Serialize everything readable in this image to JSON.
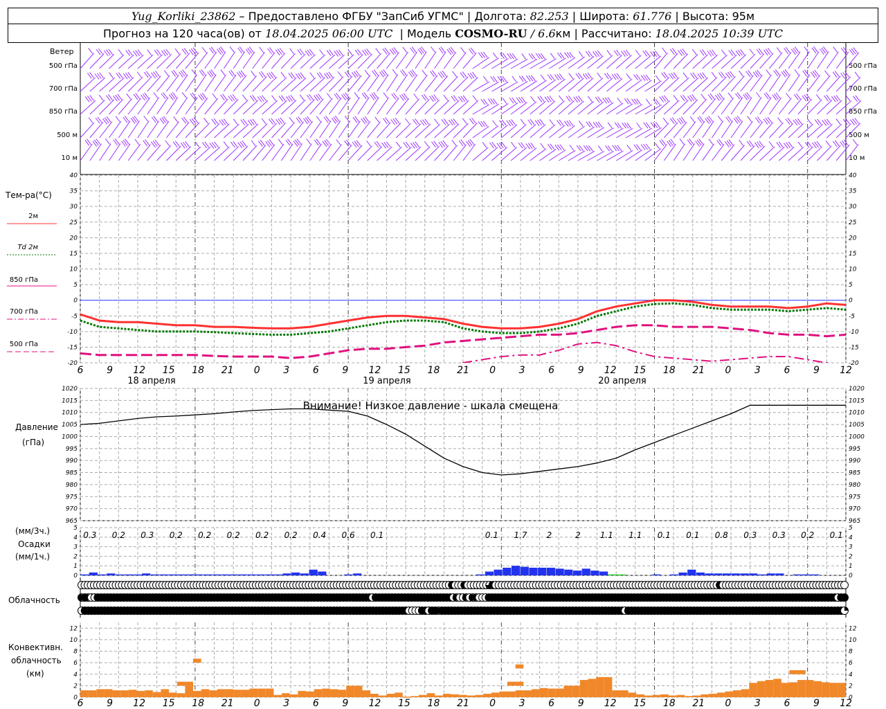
{
  "header": {
    "line1": {
      "station": "Yug_Korliki_23862",
      "provider": " – Предоставлено ФГБУ \"ЗапСиб УГМС\" | Долгота: ",
      "lon": "82.253",
      "lat_label": " | Широта: ",
      "lat": "61.776",
      "alt_label": " | Высота: ",
      "alt": "95м"
    },
    "line2": {
      "forecast_label": "Прогноз на 120 часа(ов) от ",
      "start": "18.04.2025 06:00 UTC",
      "model_label": "  | Модель ",
      "model": "COSMO-RU",
      "resolution": " / 6.6",
      "resolution_unit": "км",
      "calc_label": " | Рассчитано: ",
      "calc": "18.04.2025 10:39 UTC"
    }
  },
  "wind_panel": {
    "title": "Ветер",
    "levels": [
      "500 гПа",
      "700 гПа",
      "850 гПа",
      "500 м",
      "10 м"
    ],
    "color": "#9b30ff"
  },
  "temp_panel": {
    "title": "Тем-ра(°C)",
    "legend": [
      {
        "label": "2м",
        "color": "#ff3030",
        "style": "solid"
      },
      {
        "label": "Td 2м",
        "color": "#007700",
        "style": "dotted"
      },
      {
        "label": "850 гПа",
        "color": "#e0107f",
        "style": "solid"
      },
      {
        "label": "700 гПа",
        "color": "#e0107f",
        "style": "dashdot"
      },
      {
        "label": "500 гПа",
        "color": "#e0107f",
        "style": "dashed"
      }
    ],
    "yticks": [
      40,
      35,
      30,
      25,
      20,
      15,
      10,
      5,
      0,
      -5,
      -10,
      -15,
      -20
    ]
  },
  "pressure_panel": {
    "title": "Давление",
    "unit": "(гПа)",
    "warning": "Внимание! Низкое давление - шкала смещена",
    "yticks": [
      1020,
      1015,
      1010,
      1005,
      1000,
      995,
      990,
      985,
      980,
      975,
      970,
      965
    ]
  },
  "precip_panel": {
    "unit3": "(мм/3ч.)",
    "title": "Осадки",
    "unit1": "(мм/1ч.)",
    "labels": [
      "0.3",
      "0.2",
      "0.3",
      "0.2",
      "0.2",
      "0.2",
      "0.2",
      "0.2",
      "0.4",
      "0.6",
      "0.1",
      "",
      "",
      "",
      "0.1",
      "1.7",
      "2",
      "2",
      "1.1",
      "1.1",
      "0.1",
      "0.1",
      "0.8",
      "0.3",
      "0.3",
      "0.2",
      "0.1"
    ],
    "yticks": [
      5,
      4,
      3,
      2,
      1,
      0
    ]
  },
  "cloud_panel": {
    "title": "Облачность"
  },
  "conv_panel": {
    "title_line1": "Конвективн.",
    "title_line2": "облачность",
    "unit": "(км)",
    "yticks": [
      12,
      10,
      8,
      6,
      4,
      2,
      0
    ]
  },
  "x_axis": {
    "hour_labels": [
      "6",
      "9",
      "12",
      "15",
      "18",
      "21",
      "0",
      "3",
      "6",
      "9",
      "12",
      "15",
      "18",
      "21",
      "0",
      "3",
      "6",
      "9",
      "12",
      "15",
      "18",
      "21",
      "0",
      "3",
      "6",
      "9",
      "12"
    ],
    "dates": [
      "18 апреля",
      "19 апреля",
      "20 апреля"
    ]
  },
  "chart_data": {
    "type": "line",
    "x_hours_from_start": [
      0,
      3,
      6,
      9,
      12,
      15,
      18,
      21,
      24,
      27,
      30,
      33,
      36,
      39,
      42,
      45,
      48,
      51,
      54,
      57,
      60,
      63,
      66,
      69,
      72,
      75,
      78,
      81,
      84,
      87,
      90,
      93,
      96,
      99,
      102,
      105,
      108,
      111,
      114,
      117,
      120
    ],
    "series_temperature": [
      {
        "name": "2м",
        "values": [
          -4.5,
          -6.5,
          -7,
          -7,
          -7.5,
          -8,
          -8,
          -8.5,
          -8.5,
          -8.8,
          -9,
          -9,
          -8.5,
          -7.5,
          -6.5,
          -5.5,
          -5,
          -5,
          -5.5,
          -6,
          -7.5,
          -8.5,
          -9,
          -9,
          -8.5,
          -7.5,
          -6,
          -3.5,
          -2,
          -1,
          0,
          0,
          -0.5,
          -1.5,
          -2,
          -2,
          -2,
          -2.5,
          -2,
          -1,
          -1.5
        ]
      },
      {
        "name": "Td 2м",
        "values": [
          -6.5,
          -8.5,
          -9,
          -9.5,
          -10,
          -10,
          -10,
          -10.2,
          -10.5,
          -10.8,
          -11,
          -11,
          -10.5,
          -10,
          -9,
          -8,
          -7,
          -6.5,
          -6.5,
          -7,
          -9,
          -10,
          -10.5,
          -10.5,
          -10,
          -9,
          -7.5,
          -5,
          -3.5,
          -2,
          -1.2,
          -1,
          -1.5,
          -2.5,
          -3,
          -3,
          -3,
          -3.5,
          -3,
          -2.5,
          -3
        ]
      },
      {
        "name": "850 гПа",
        "values": [
          -17,
          -17.5,
          -17.5,
          -17.5,
          -17.5,
          -17.5,
          -17.5,
          -17.8,
          -18,
          -18,
          -18,
          -18.5,
          -18,
          -17,
          -16,
          -15.5,
          -15.5,
          -15,
          -14.5,
          -13.5,
          -13,
          -12.5,
          -12,
          -11.5,
          -11,
          -11,
          -10.5,
          -9.5,
          -8.5,
          -8,
          -8,
          -8.5,
          -8.5,
          -8.5,
          -9,
          -9.5,
          -10.5,
          -11,
          -11,
          -11.5,
          -11
        ]
      },
      {
        "name": "700 гПа",
        "values": [
          null,
          null,
          null,
          null,
          null,
          null,
          null,
          null,
          null,
          null,
          null,
          null,
          null,
          null,
          null,
          null,
          null,
          null,
          null,
          -21,
          -20,
          -19,
          -18,
          -17.5,
          -17.5,
          -16,
          -14,
          -13.5,
          -14.5,
          -16.5,
          -18,
          -18.5,
          -19,
          -19.5,
          -19,
          -18.5,
          -18,
          -18,
          -19,
          -20,
          -21
        ]
      },
      {
        "name": "500 гПа",
        "values": []
      }
    ],
    "series_pressure": {
      "name": "Давление",
      "values": [
        1005,
        1005.5,
        1006.5,
        1007.5,
        1008.2,
        1008.5,
        1009,
        1009.5,
        1010.2,
        1010.8,
        1011.2,
        1011.5,
        1011.5,
        1011,
        1010.5,
        1008.5,
        1005,
        1001,
        996,
        991,
        987.5,
        985,
        984,
        984.5,
        985.5,
        986.5,
        987.5,
        989,
        991,
        994.5,
        997.5,
        1000.5,
        1003.5,
        1006.5,
        1009.5,
        1013,
        1013,
        1013,
        1013,
        1013,
        1013
      ]
    },
    "precip_1h_mm": [
      0.1,
      0.3,
      0.1,
      0.2,
      0.1,
      0.1,
      0.1,
      0.2,
      0.1,
      0.1,
      0.1,
      0.1,
      0.1,
      0.1,
      0.1,
      0.1,
      0.1,
      0.1,
      0.1,
      0.1,
      0.1,
      0.1,
      0.1,
      0.2,
      0.3,
      0.2,
      0.6,
      0.4,
      0.0,
      0.0,
      0.1,
      0.2,
      0.0,
      0.0,
      0.0,
      0.0,
      0.0,
      0.0,
      0.0,
      0.0,
      0.0,
      0.0,
      0.0,
      0.0,
      0.0,
      0.1,
      0.4,
      0.6,
      0.8,
      1.0,
      0.9,
      0.8,
      0.8,
      0.8,
      0.7,
      0.6,
      0.5,
      0.7,
      0.5,
      0.4,
      0.1,
      0.1,
      0.0,
      0.0,
      0.0,
      0.1,
      0.0,
      0.1,
      0.3,
      0.6,
      0.3,
      0.2,
      0.2,
      0.2,
      0.2,
      0.2,
      0.2,
      0.1,
      0.2,
      0.2,
      0.0,
      0.1,
      0.1,
      0.1,
      0.0,
      0.0,
      0.0
    ],
    "precip_green_index": [
      60,
      61
    ],
    "conv_cloud_km": [
      [
        1.2,
        1.8
      ],
      [
        1.2,
        1.8
      ],
      [
        1.4,
        1.7
      ],
      [
        1.4,
        1.7
      ],
      [
        1.2,
        1.6
      ],
      [
        1.2,
        1.8
      ],
      [
        1.3,
        1.7
      ],
      [
        1.1,
        1.7
      ],
      [
        1.2,
        1.6
      ],
      [
        0.9,
        1.6
      ],
      [
        1.4,
        1.6
      ],
      [
        0.8,
        1.3
      ],
      [
        0.7,
        1.1
      ],
      [
        2.0,
        1.1
      ],
      [
        1.1,
        0.8
      ],
      [
        1.4,
        0.8
      ],
      [
        1.2,
        0.9
      ],
      [
        1.4,
        0.8
      ],
      [
        1.4,
        0.9
      ],
      [
        1.3,
        0.9
      ],
      [
        1.3,
        0.9
      ],
      [
        1.5,
        1.0
      ],
      [
        1.5,
        1.0
      ],
      [
        1.5,
        1.0
      ],
      [
        0.4,
        1.2
      ],
      [
        0.7,
        0.9
      ],
      [
        0.5,
        1.0
      ],
      [
        1.1,
        1.0
      ],
      [
        1.0,
        0.9
      ],
      [
        1.4,
        1.0
      ],
      [
        1.5,
        0.8
      ],
      [
        1.4,
        1.0
      ],
      [
        1.3,
        1.0
      ],
      [
        2.0,
        1.3
      ],
      [
        2.0,
        1.2
      ],
      [
        1.2,
        0.9
      ],
      [
        0.6,
        0.6
      ],
      [
        0.3,
        0.5
      ],
      [
        0.6,
        0.3
      ],
      [
        0.8,
        0.5
      ],
      [
        0.1,
        0.3
      ],
      [
        0.2,
        0.4
      ],
      [
        0.4,
        0.3
      ],
      [
        0.7,
        0.4
      ],
      [
        0.3,
        0.4
      ],
      [
        0.6,
        0.4
      ],
      [
        0.5,
        0.5
      ],
      [
        0.4,
        0.5
      ],
      [
        0.3,
        0.2
      ],
      [
        0.4,
        0.5
      ],
      [
        0.6,
        0.5
      ],
      [
        0.8,
        0.6
      ],
      [
        1.0,
        0.6
      ],
      [
        1.0,
        0.6
      ],
      [
        1.2,
        0.7
      ],
      [
        1.2,
        0.8
      ],
      [
        1.4,
        0.8
      ],
      [
        1.6,
        1.2
      ],
      [
        1.5,
        1.4
      ],
      [
        1.5,
        1.5
      ],
      [
        2.0,
        1.8
      ],
      [
        2.0,
        2.2
      ],
      [
        3.0,
        2.5
      ],
      [
        3.2,
        2.5
      ],
      [
        3.5,
        2.8
      ],
      [
        3.5,
        3.2
      ],
      [
        1.2,
        0.8
      ],
      [
        1.2,
        0.5
      ],
      [
        0.8,
        0.3
      ],
      [
        0.5,
        0.4
      ],
      [
        0.3,
        0.2
      ],
      [
        0.4,
        0.1
      ],
      [
        0.5,
        0.3
      ],
      [
        0.3,
        0.3
      ],
      [
        0.4,
        0.3
      ],
      [
        0.2,
        0.5
      ],
      [
        0.3,
        0.4
      ],
      [
        0.5,
        0.6
      ],
      [
        0.6,
        0.7
      ],
      [
        0.8,
        0.8
      ],
      [
        1.0,
        0.6
      ],
      [
        1.2,
        0.8
      ],
      [
        1.4,
        0.8
      ],
      [
        2.5,
        1.5
      ],
      [
        2.8,
        1.6
      ],
      [
        3.0,
        1.8
      ],
      [
        3.2,
        1.8
      ],
      [
        2.5,
        2.0
      ],
      [
        2.6,
        1.8
      ],
      [
        3.0,
        1.6
      ],
      [
        3.0,
        1.5
      ],
      [
        2.8,
        1.5
      ],
      [
        2.6,
        1.6
      ],
      [
        2.5,
        1.8
      ],
      [
        2.5,
        1.8
      ]
    ],
    "conv_extra_bars": [
      [
        12,
        2,
        2
      ],
      [
        14,
        1,
        6
      ],
      [
        53,
        2,
        2
      ],
      [
        54,
        1,
        5
      ],
      [
        88,
        2,
        4
      ]
    ],
    "cloud_rows": {
      "top": "ooooooooooooooooooooooooooooooooooooooooooooooooooooooooooooooooooooooooooooooooooooooooooooooooooooooooooooooooooooooqBooohoTTTToTdhbooooooooooooooooooooooooooooooooooooooooooooooooooooooooooooooooooooooohoooooooooooooooooooooooooooooooooooooooo",
      "mid": "hBhqqBBBBBBBBBBBBBBBBBBBBBBBBBBBBBBBBBBBBBBBBBBBBBBBBBBBBBBBBBBBBBBBBBBBBBBBBBBBBBBBBBBBBBqBBBBBBBBBBBBBBBBBBBBBBBBqhqqhohhoooBBBBBBBBBBBBBBBBBBBBBBBBBBBBBBBBBBBBBBBBBBBBBBBBBBBBBBBBBBBBBBBBBBBBBBBBBBBBBBBBBBBBBBBBBBBBBBBBBBBBBBBBBBBBqBB",
      "low": "qBBBBBBBBBBBBBBBBBBBBBBBBBBBBBBBBBBBBBBBBBBBBBBBBBBBBBBBBBBBBBBBBBBBBBBBBBBBBBBBBBBBBBBBBBBBBBBBBBBBqooqBBqBBhBBBBBBBBBBBBBBBBBBBBBBBBBBBBBBBBBBBBBBBBBBBBBBBBBBBBBBBBqBBBBBBBBBBBBBBBBBBBBBBBBBBBBBBBBBBBBBBBBBBBBBBBBBBBBBBBBBBBBBBBBBBq"
    }
  }
}
